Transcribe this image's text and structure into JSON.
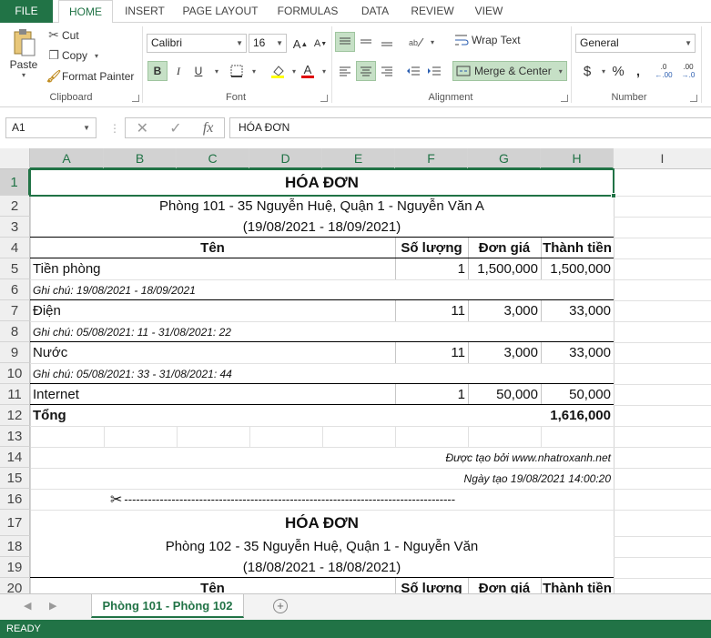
{
  "ribbon_tabs": [
    "FILE",
    "HOME",
    "INSERT",
    "PAGE LAYOUT",
    "FORMULAS",
    "DATA",
    "REVIEW",
    "VIEW"
  ],
  "clipboard": {
    "paste": "Paste",
    "cut": "Cut",
    "copy": "Copy",
    "format_painter": "Format Painter",
    "label": "Clipboard"
  },
  "font": {
    "name": "Calibri",
    "size": "16",
    "bold": "B",
    "italic": "I",
    "underline": "U",
    "label": "Font",
    "grow": "A",
    "shrink": "A",
    "color_a": "A"
  },
  "alignment": {
    "wrap": "Wrap Text",
    "merge": "Merge & Center",
    "label": "Alignment"
  },
  "number": {
    "format": "General",
    "currency": "$",
    "percent": "%",
    "comma": ",",
    "inc": ".00",
    "dec": ".0",
    "label": "Number"
  },
  "formula_bar": {
    "cell_ref": "A1",
    "fx": "fx",
    "content": "HÓA ĐƠN"
  },
  "columns": [
    "A",
    "B",
    "C",
    "D",
    "E",
    "F",
    "G",
    "H",
    "I"
  ],
  "rows": [
    "1",
    "2",
    "3",
    "4",
    "5",
    "6",
    "7",
    "8",
    "9",
    "10",
    "11",
    "12",
    "13",
    "14",
    "15",
    "16",
    "17",
    "18",
    "19",
    "20"
  ],
  "invoice1": {
    "title": "HÓA ĐƠN",
    "address": "Phòng 101 - 35 Nguyễn Huệ, Quận 1 - Nguyễn Văn A",
    "period": "(19/08/2021 - 18/09/2021)",
    "headers": {
      "name": "Tên",
      "qty": "Số lượng",
      "price": "Đơn giá",
      "total": "Thành tiền"
    },
    "items": [
      {
        "name": "Tiền phòng",
        "qty": "1",
        "price": "1,500,000",
        "total": "1,500,000",
        "note": "Ghi chú: 19/08/2021 - 18/09/2021"
      },
      {
        "name": "Điện",
        "qty": "11",
        "price": "3,000",
        "total": "33,000",
        "note": "Ghi chú: 05/08/2021: 11 - 31/08/2021: 22"
      },
      {
        "name": "Nước",
        "qty": "11",
        "price": "3,000",
        "total": "33,000",
        "note": "Ghi chú: 05/08/2021: 33 - 31/08/2021: 44"
      },
      {
        "name": "Internet",
        "qty": "1",
        "price": "50,000",
        "total": "50,000"
      }
    ],
    "sum_label": "Tổng",
    "sum_value": "1,616,000",
    "created_by": "Được tạo bởi www.nhatroxanh.net",
    "created_at": "Ngày tạo 19/08/2021 14:00:20",
    "cut_line": "------------------------------------------------------------------------------------"
  },
  "invoice2": {
    "title": "HÓA ĐƠN",
    "address": "Phòng 102 - 35 Nguyễn Huệ, Quận 1 - Nguyễn Văn",
    "period": "(18/08/2021 - 18/08/2021)",
    "headers": {
      "name": "Tên",
      "qty": "Số lượng",
      "price": "Đơn giá",
      "total": "Thành tiền"
    }
  },
  "sheet_tab": "Phòng 101 - Phòng 102",
  "add_sheet": "+",
  "status": "READY",
  "colors": {
    "excel_green": "#217346",
    "accent_light": "#c6e0c6"
  }
}
